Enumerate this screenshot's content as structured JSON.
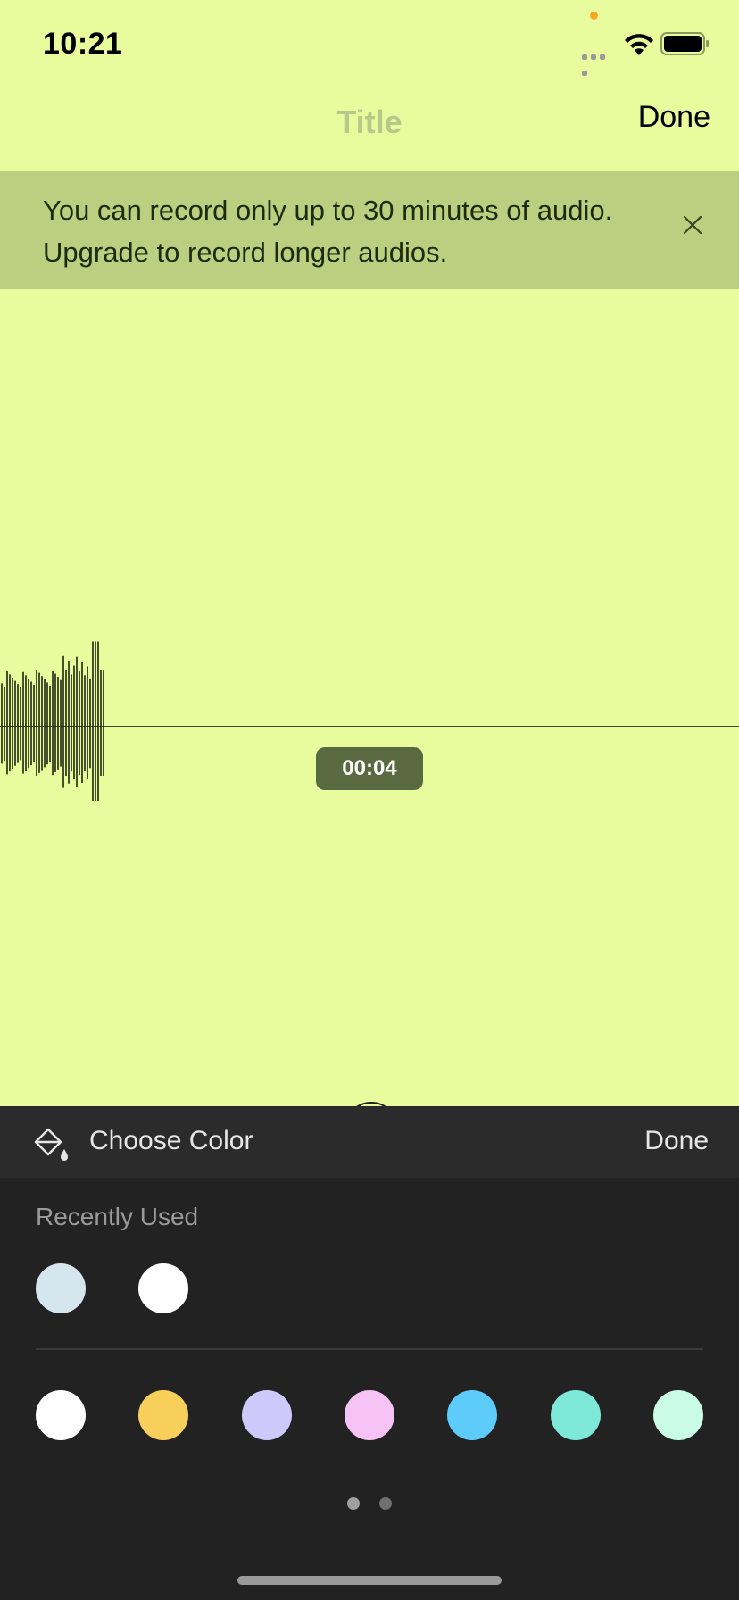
{
  "status": {
    "time": "10:21"
  },
  "nav": {
    "title": "Title",
    "done_label": "Done"
  },
  "banner": {
    "message": "You can record only up to 30 minutes of audio. Upgrade to record longer audios."
  },
  "recording": {
    "elapsed": "00:04"
  },
  "color_sheet": {
    "title": "Choose Color",
    "done_label": "Done",
    "recent_label": "Recently Used",
    "recent_colors": [
      "#d6e6ef",
      "#ffffff"
    ],
    "palette_colors": [
      "#ffffff",
      "#f8cf5a",
      "#cfc8fb",
      "#f7c2f6",
      "#5dccfb",
      "#7ee8d9",
      "#c9fbe6"
    ],
    "page_indicator": {
      "pages": 2,
      "current": 1
    }
  },
  "colors": {
    "background": "#e8fc9e",
    "banner": "#bbcf80",
    "sheet": "#222222"
  }
}
